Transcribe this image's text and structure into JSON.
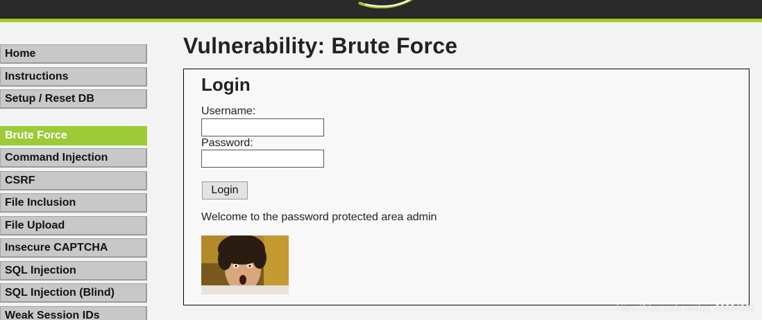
{
  "menu": {
    "group1": [
      "Home",
      "Instructions",
      "Setup / Reset DB"
    ],
    "group2": [
      "Brute Force",
      "Command Injection",
      "CSRF",
      "File Inclusion",
      "File Upload",
      "Insecure CAPTCHA",
      "SQL Injection",
      "SQL Injection (Blind)",
      "Weak Session IDs"
    ]
  },
  "page": {
    "title": "Vulnerability: Brute Force"
  },
  "login": {
    "heading": "Login",
    "username_label": "Username:",
    "password_label": "Password:",
    "username_value": "",
    "password_value": "",
    "button_label": "Login",
    "welcome_text": "Welcome to the password protected area admin"
  },
  "watermark": "https://blog.csdn.net/qq_30834982",
  "colors": {
    "accent": "#9ccb37",
    "topbar": "#2a2a2a",
    "background": "#f3f3f3"
  }
}
